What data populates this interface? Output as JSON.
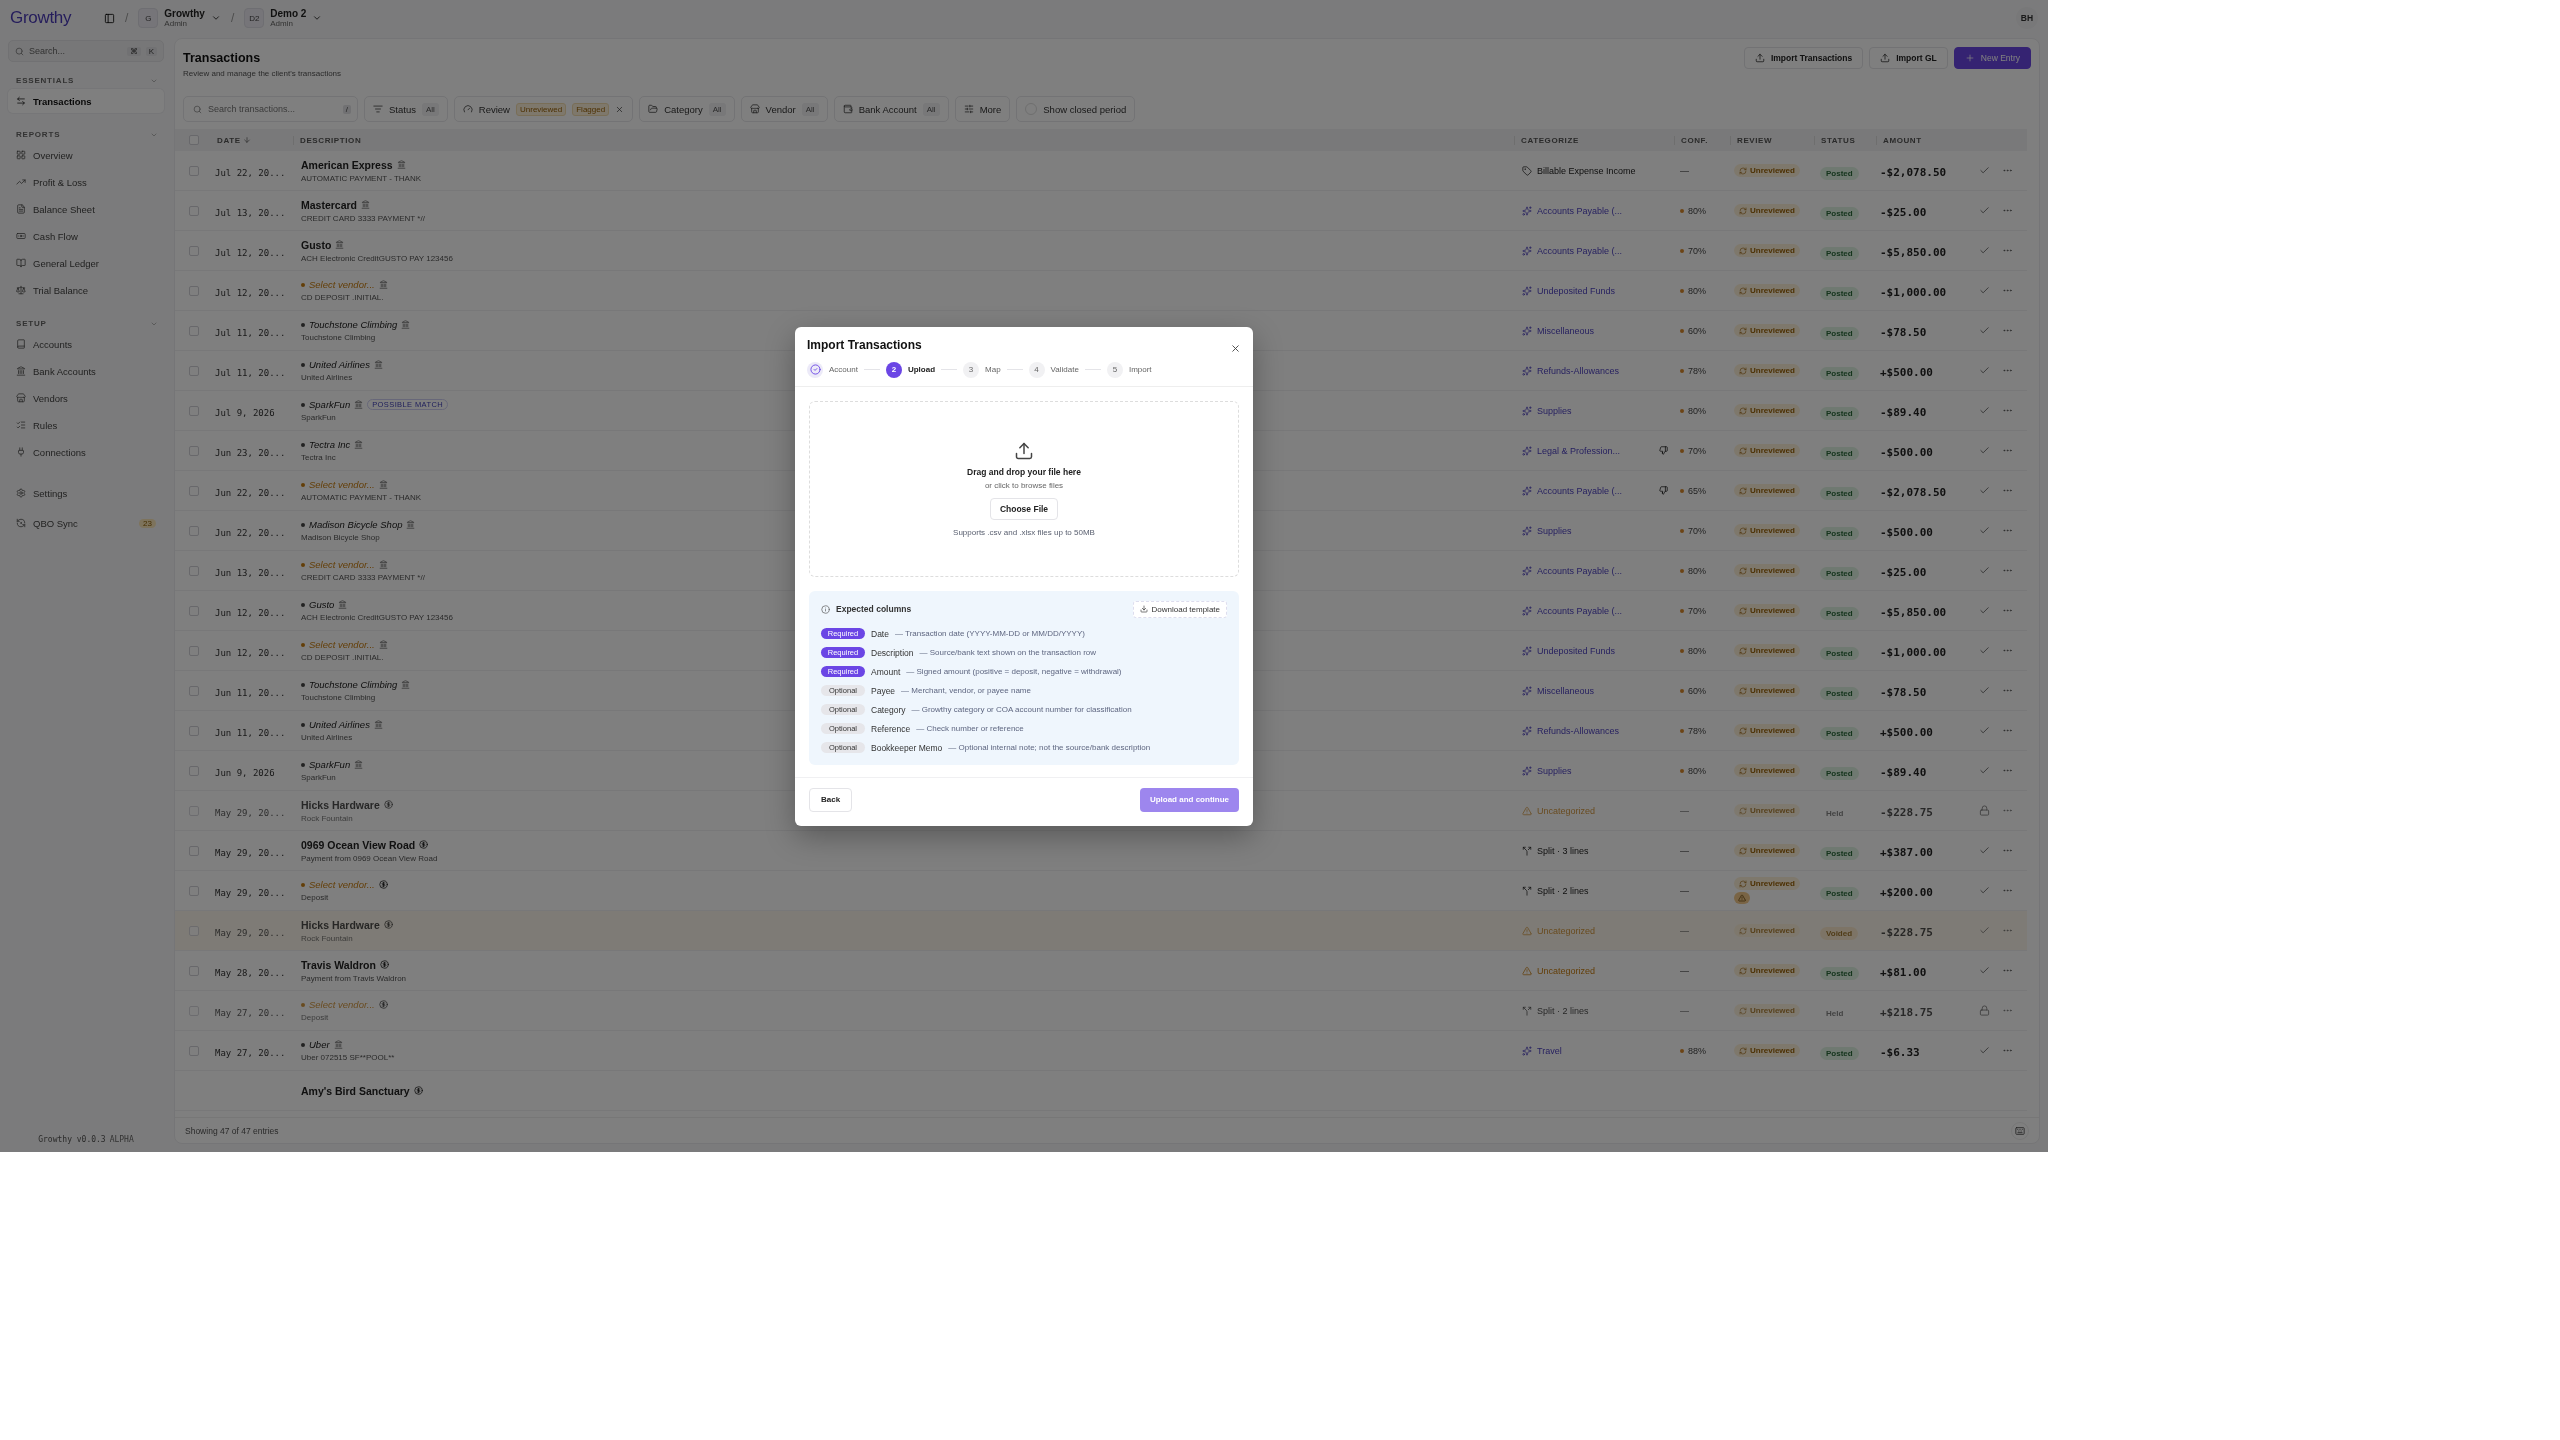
{
  "app": {
    "logo": "Growthy",
    "breadcrumbs": [
      {
        "separator": "/",
        "initials": "G",
        "name": "Growthy",
        "role": "Admin"
      },
      {
        "separator": "/",
        "initials": "D2",
        "name": "Demo 2",
        "role": "Admin"
      }
    ],
    "user_initials": "BH"
  },
  "sidebar": {
    "search": {
      "placeholder": "Search...",
      "keys": [
        "⌘",
        "K"
      ]
    },
    "sections": [
      {
        "title": "ESSENTIALS",
        "items": [
          {
            "label": "Transactions",
            "selected": true
          }
        ]
      },
      {
        "title": "REPORTS",
        "items": [
          {
            "label": "Overview",
            "selected": false
          },
          {
            "label": "Profit & Loss",
            "selected": false
          },
          {
            "label": "Balance Sheet",
            "selected": false
          },
          {
            "label": "Cash Flow",
            "selected": false
          },
          {
            "label": "General Ledger",
            "selected": false
          },
          {
            "label": "Trial Balance",
            "selected": false
          }
        ]
      },
      {
        "title": "SETUP",
        "items": [
          {
            "label": "Accounts",
            "selected": false
          },
          {
            "label": "Bank Accounts",
            "selected": false
          },
          {
            "label": "Vendors",
            "selected": false
          },
          {
            "label": "Rules",
            "selected": false
          },
          {
            "label": "Connections",
            "selected": false
          }
        ]
      }
    ],
    "bottom_items": [
      {
        "label": "Settings",
        "selected": false
      },
      {
        "label": "QBO Sync",
        "selected": false,
        "badge": "23"
      }
    ],
    "version": "Growthy v0.0.3",
    "version_tag": "ALPHA"
  },
  "page": {
    "title": "Transactions",
    "subtitle": "Review and manage the client's transactions",
    "actions": [
      {
        "label": "Import Transactions",
        "primary": false
      },
      {
        "label": "Import GL",
        "primary": false
      },
      {
        "label": "New Entry",
        "primary": true
      }
    ]
  },
  "filters": {
    "search": {
      "placeholder": "Search transactions...",
      "key": "/"
    },
    "chips": [
      {
        "label": "Status",
        "values": [
          "All"
        ],
        "clearable": false
      },
      {
        "label": "Review",
        "values": [
          "Unreviewed",
          "Flagged"
        ],
        "clearable": true
      },
      {
        "label": "Category",
        "values": [
          "All"
        ],
        "clearable": false
      },
      {
        "label": "Vendor",
        "values": [
          "All"
        ],
        "clearable": false
      },
      {
        "label": "Bank Account",
        "values": [
          "All"
        ],
        "clearable": false
      },
      {
        "label": "More",
        "clearable": false
      }
    ],
    "show_closed": {
      "label": "Show closed period",
      "on": false
    }
  },
  "table": {
    "select_all": {
      "checked": false
    },
    "columns": [
      "DATE",
      "DESCRIPTION",
      "CATEGORIZE",
      "CONF.",
      "REVIEW",
      "STATUS",
      "AMOUNT"
    ],
    "rows": [
      {
        "checked": false,
        "date": "Jul 22, 20...",
        "vendor": {
          "text": "American Express",
          "suggested": false
        },
        "synced": false,
        "memo": "AUTOMATIC PAYMENT - THANK",
        "category": {
          "kind": "rule",
          "label": "Billable Expense Income"
        },
        "disputed": false,
        "conf": "—",
        "review": "Unreviewed",
        "flagged": false,
        "status": "Posted",
        "locked": false,
        "voided": false,
        "amount": "-$2,078.50"
      },
      {
        "checked": false,
        "date": "Jul 13, 20...",
        "vendor": {
          "text": "Mastercard",
          "suggested": false
        },
        "synced": false,
        "memo": "CREDIT CARD 3333 PAYMENT *//",
        "category": {
          "kind": "ai",
          "label": "Accounts Payable (..."
        },
        "disputed": false,
        "conf": "80%",
        "review": "Unreviewed",
        "flagged": false,
        "status": "Posted",
        "locked": false,
        "voided": false,
        "amount": "-$25.00"
      },
      {
        "checked": false,
        "date": "Jul 12, 20...",
        "vendor": {
          "text": "Gusto",
          "suggested": false
        },
        "synced": false,
        "memo": "ACH Electronic CreditGUSTO PAY 123456",
        "category": {
          "kind": "ai",
          "label": "Accounts Payable (..."
        },
        "disputed": false,
        "conf": "70%",
        "review": "Unreviewed",
        "flagged": false,
        "status": "Posted",
        "locked": false,
        "voided": false,
        "amount": "-$5,850.00"
      },
      {
        "checked": false,
        "date": "Jul 12, 20...",
        "vendor": {
          "placeholder": "Select vendor..."
        },
        "synced": false,
        "memo": "CD DEPOSIT .INITIAL.",
        "category": {
          "kind": "ai",
          "label": "Undeposited Funds"
        },
        "disputed": false,
        "conf": "80%",
        "review": "Unreviewed",
        "flagged": false,
        "status": "Posted",
        "locked": false,
        "voided": false,
        "amount": "-$1,000.00"
      },
      {
        "checked": false,
        "date": "Jul 11, 20...",
        "vendor": {
          "text": "Touchstone Climbing",
          "suggested": true
        },
        "synced": false,
        "memo": "Touchstone Climbing",
        "category": {
          "kind": "ai",
          "label": "Miscellaneous"
        },
        "disputed": false,
        "conf": "60%",
        "review": "Unreviewed",
        "flagged": false,
        "status": "Posted",
        "locked": false,
        "voided": false,
        "amount": "-$78.50"
      },
      {
        "checked": false,
        "date": "Jul 11, 20...",
        "vendor": {
          "text": "United Airlines",
          "suggested": true
        },
        "synced": false,
        "memo": "United Airlines",
        "category": {
          "kind": "ai",
          "label": "Refunds-Allowances"
        },
        "disputed": false,
        "conf": "78%",
        "review": "Unreviewed",
        "flagged": false,
        "status": "Posted",
        "locked": false,
        "voided": false,
        "amount": "+$500.00"
      },
      {
        "checked": false,
        "date": "Jul 9, 2026",
        "vendor": {
          "text": "SparkFun",
          "suggested": true
        },
        "synced": false,
        "badge": "POSSIBLE MATCH",
        "memo": "SparkFun",
        "category": {
          "kind": "ai",
          "label": "Supplies"
        },
        "disputed": false,
        "conf": "80%",
        "review": "Unreviewed",
        "flagged": false,
        "status": "Posted",
        "locked": false,
        "voided": false,
        "amount": "-$89.40"
      },
      {
        "checked": false,
        "date": "Jun 23, 20...",
        "vendor": {
          "text": "Tectra Inc",
          "suggested": true
        },
        "synced": false,
        "memo": "Tectra Inc",
        "category": {
          "kind": "ai",
          "label": "Legal & Profession..."
        },
        "disputed": true,
        "conf": "70%",
        "review": "Unreviewed",
        "flagged": false,
        "status": "Posted",
        "locked": false,
        "voided": false,
        "amount": "-$500.00"
      },
      {
        "checked": false,
        "date": "Jun 22, 20...",
        "vendor": {
          "placeholder": "Select vendor..."
        },
        "synced": false,
        "memo": "AUTOMATIC PAYMENT - THANK",
        "category": {
          "kind": "ai",
          "label": "Accounts Payable (..."
        },
        "disputed": true,
        "conf": "65%",
        "review": "Unreviewed",
        "flagged": false,
        "status": "Posted",
        "locked": false,
        "voided": false,
        "amount": "-$2,078.50"
      },
      {
        "checked": false,
        "date": "Jun 22, 20...",
        "vendor": {
          "text": "Madison Bicycle Shop",
          "suggested": true
        },
        "synced": false,
        "memo": "Madison Bicycle Shop",
        "category": {
          "kind": "ai",
          "label": "Supplies"
        },
        "disputed": false,
        "conf": "70%",
        "review": "Unreviewed",
        "flagged": false,
        "status": "Posted",
        "locked": false,
        "voided": false,
        "amount": "-$500.00"
      },
      {
        "checked": false,
        "date": "Jun 13, 20...",
        "vendor": {
          "placeholder": "Select vendor..."
        },
        "synced": false,
        "memo": "CREDIT CARD 3333 PAYMENT *//",
        "category": {
          "kind": "ai",
          "label": "Accounts Payable (..."
        },
        "disputed": false,
        "conf": "80%",
        "review": "Unreviewed",
        "flagged": false,
        "status": "Posted",
        "locked": false,
        "voided": false,
        "amount": "-$25.00"
      },
      {
        "checked": false,
        "date": "Jun 12, 20...",
        "vendor": {
          "text": "Gusto",
          "suggested": true
        },
        "synced": false,
        "memo": "ACH Electronic CreditGUSTO PAY 123456",
        "category": {
          "kind": "ai",
          "label": "Accounts Payable (..."
        },
        "disputed": false,
        "conf": "70%",
        "review": "Unreviewed",
        "flagged": false,
        "status": "Posted",
        "locked": false,
        "voided": false,
        "amount": "-$5,850.00"
      },
      {
        "checked": false,
        "date": "Jun 12, 20...",
        "vendor": {
          "placeholder": "Select vendor..."
        },
        "synced": false,
        "memo": "CD DEPOSIT .INITIAL.",
        "category": {
          "kind": "ai",
          "label": "Undeposited Funds"
        },
        "disputed": false,
        "conf": "80%",
        "review": "Unreviewed",
        "flagged": false,
        "status": "Posted",
        "locked": false,
        "voided": false,
        "amount": "-$1,000.00"
      },
      {
        "checked": false,
        "date": "Jun 11, 20...",
        "vendor": {
          "text": "Touchstone Climbing",
          "suggested": true
        },
        "synced": false,
        "memo": "Touchstone Climbing",
        "category": {
          "kind": "ai",
          "label": "Miscellaneous"
        },
        "disputed": false,
        "conf": "60%",
        "review": "Unreviewed",
        "flagged": false,
        "status": "Posted",
        "locked": false,
        "voided": false,
        "amount": "-$78.50"
      },
      {
        "checked": false,
        "date": "Jun 11, 20...",
        "vendor": {
          "text": "United Airlines",
          "suggested": true
        },
        "synced": false,
        "memo": "United Airlines",
        "category": {
          "kind": "ai",
          "label": "Refunds-Allowances"
        },
        "disputed": false,
        "conf": "78%",
        "review": "Unreviewed",
        "flagged": false,
        "status": "Posted",
        "locked": false,
        "voided": false,
        "amount": "+$500.00"
      },
      {
        "checked": false,
        "date": "Jun 9, 2026",
        "vendor": {
          "text": "SparkFun",
          "suggested": true
        },
        "synced": false,
        "memo": "SparkFun",
        "category": {
          "kind": "ai",
          "label": "Supplies"
        },
        "disputed": false,
        "conf": "80%",
        "review": "Unreviewed",
        "flagged": false,
        "status": "Posted",
        "locked": false,
        "voided": false,
        "amount": "-$89.40"
      },
      {
        "checked": false,
        "date": "May 29, 20...",
        "vendor": {
          "text": "Hicks Hardware",
          "suggested": false
        },
        "synced": true,
        "memo": "Rock Fountain",
        "category": {
          "kind": "warning",
          "label": "Uncategorized"
        },
        "disputed": false,
        "conf": "—",
        "review": "Unreviewed",
        "flagged": false,
        "status": "Held",
        "locked": true,
        "voided": false,
        "amount": "-$228.75"
      },
      {
        "checked": false,
        "date": "May 29, 20...",
        "vendor": {
          "text": "0969 Ocean View Road",
          "suggested": false
        },
        "synced": true,
        "memo": "Payment from 0969 Ocean View Road",
        "category": {
          "kind": "split",
          "label": "Split · 3 lines"
        },
        "disputed": false,
        "conf": "—",
        "review": "Unreviewed",
        "flagged": false,
        "status": "Posted",
        "locked": false,
        "voided": false,
        "amount": "+$387.00"
      },
      {
        "checked": false,
        "date": "May 29, 20...",
        "vendor": {
          "placeholder": "Select vendor..."
        },
        "synced": true,
        "memo": "Deposit",
        "category": {
          "kind": "split",
          "label": "Split · 2 lines"
        },
        "disputed": false,
        "conf": "—",
        "review": "Unreviewed",
        "flagged": true,
        "status": "Posted",
        "locked": false,
        "voided": false,
        "amount": "+$200.00"
      },
      {
        "checked": false,
        "date": "May 29, 20...",
        "vendor": {
          "text": "Hicks Hardware",
          "suggested": false
        },
        "synced": true,
        "memo": "Rock Fountain",
        "category": {
          "kind": "warning",
          "label": "Uncategorized"
        },
        "disputed": false,
        "conf": "—",
        "review": "Unreviewed",
        "flagged": false,
        "status": "Voided",
        "locked": false,
        "voided": true,
        "amount": "-$228.75"
      },
      {
        "checked": false,
        "date": "May 28, 20...",
        "vendor": {
          "text": "Travis Waldron",
          "suggested": false
        },
        "synced": true,
        "memo": "Payment from Travis Waldron",
        "category": {
          "kind": "warning",
          "label": "Uncategorized"
        },
        "disputed": false,
        "conf": "—",
        "review": "Unreviewed",
        "flagged": false,
        "status": "Posted",
        "locked": false,
        "voided": false,
        "amount": "+$81.00"
      },
      {
        "checked": false,
        "date": "May 27, 20...",
        "vendor": {
          "placeholder": "Select vendor..."
        },
        "synced": true,
        "memo": "Deposit",
        "category": {
          "kind": "split",
          "label": "Split · 2 lines"
        },
        "disputed": false,
        "conf": "—",
        "review": "Unreviewed",
        "flagged": false,
        "status": "Held",
        "locked": true,
        "voided": false,
        "amount": "+$218.75"
      },
      {
        "checked": false,
        "date": "May 27, 20...",
        "vendor": {
          "text": "Uber",
          "suggested": true
        },
        "synced": false,
        "memo": "Uber 072515 SF**POOL**",
        "category": {
          "kind": "ai",
          "label": "Travel"
        },
        "disputed": false,
        "conf": "88%",
        "review": "Unreviewed",
        "flagged": false,
        "status": "Posted",
        "locked": false,
        "voided": false,
        "amount": "-$6.33"
      },
      {
        "vendor": {
          "text": "Amy's Bird Sanctuary",
          "suggested": false
        },
        "synced": true
      }
    ],
    "footer": "Showing 47 of 47 entries"
  },
  "dialog": {
    "title": "Import Transactions",
    "steps": [
      {
        "label": "Account",
        "selected": false,
        "completed": true
      },
      {
        "number": "2",
        "label": "Upload",
        "selected": true,
        "completed": false
      },
      {
        "number": "3",
        "label": "Map",
        "selected": false,
        "completed": false
      },
      {
        "number": "4",
        "label": "Validate",
        "selected": false,
        "completed": false
      },
      {
        "number": "5",
        "label": "Import",
        "selected": false,
        "completed": false
      }
    ],
    "dropzone": {
      "title": "Drag and drop your file here",
      "hint": "or click to browse files",
      "button": "Choose File",
      "note": "Supports .csv and .xlsx files up to 50MB"
    },
    "expected": {
      "title": "Expected columns",
      "download": "Download template",
      "columns": [
        {
          "tag": "Required",
          "required": true,
          "name": "Date",
          "description": "— Transaction date (YYYY-MM-DD or MM/DD/YYYY)"
        },
        {
          "tag": "Required",
          "required": true,
          "name": "Description",
          "description": "— Source/bank text shown on the transaction row"
        },
        {
          "tag": "Required",
          "required": true,
          "name": "Amount",
          "description": "— Signed amount (positive = deposit, negative = withdrawal)"
        },
        {
          "tag": "Optional",
          "required": false,
          "name": "Payee",
          "description": "— Merchant, vendor, or payee name"
        },
        {
          "tag": "Optional",
          "required": false,
          "name": "Category",
          "description": "— Growthy category or COA account number for classification"
        },
        {
          "tag": "Optional",
          "required": false,
          "name": "Reference",
          "description": "— Check number or reference"
        },
        {
          "tag": "Optional",
          "required": false,
          "name": "Bookkeeper Memo",
          "description": "— Optional internal note; not the source/bank description"
        }
      ]
    },
    "back": "Back",
    "submit": {
      "label": "Upload and continue",
      "disabled": true
    }
  }
}
